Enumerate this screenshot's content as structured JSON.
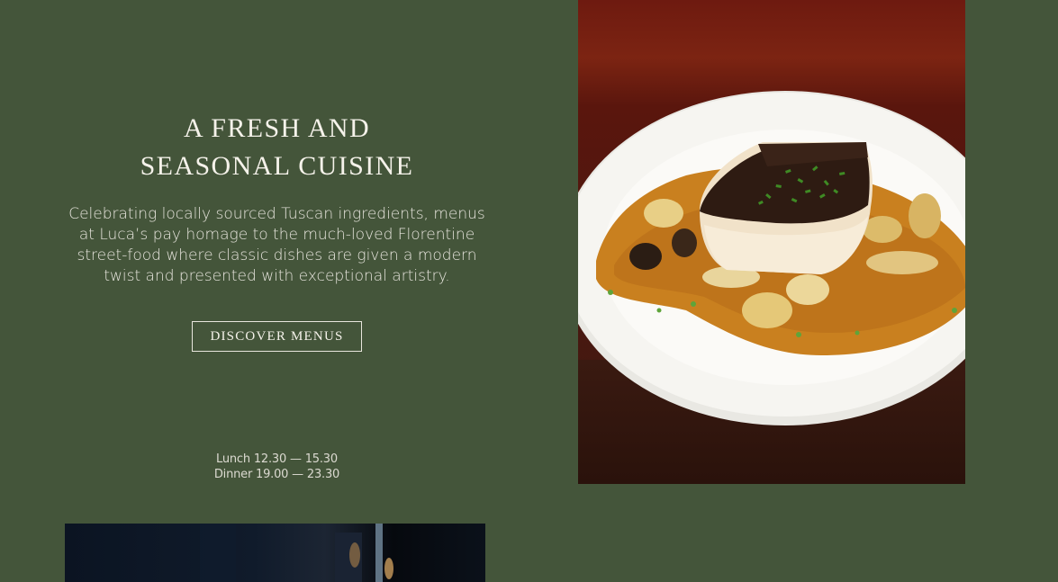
{
  "intro": {
    "heading_line1": "A FRESH AND",
    "heading_line2": "SEASONAL CUISINE",
    "body": "Celebrating locally sourced Tuscan ingredients, menus at Luca’s pay homage to the much-loved Florentine street-food where classic dishes are given a modern twist and presented with exceptional artistry.",
    "cta_label": "DISCOVER MENUS"
  },
  "hours": {
    "lunch": "Lunch 12.30 — 15.30",
    "dinner": "Dinner 19.00 — 23.30"
  },
  "colors": {
    "background": "#44553a",
    "text": "#f1eee6",
    "plate": "#f4f3ef",
    "sauce": "#c87a1f"
  }
}
